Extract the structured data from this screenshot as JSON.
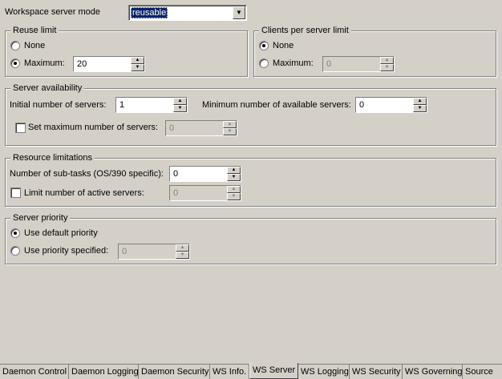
{
  "workspace_mode": {
    "label": "Workspace server mode",
    "value": "reusable"
  },
  "reuse_limit": {
    "title": "Reuse limit",
    "none_label": "None",
    "maximum_label": "Maximum:",
    "maximum_value": "20",
    "selected": "maximum"
  },
  "clients_limit": {
    "title": "Clients per server limit",
    "none_label": "None",
    "maximum_label": "Maximum:",
    "maximum_value": "0",
    "selected": "none"
  },
  "server_availability": {
    "title": "Server availability",
    "initial_label": "Initial number of servers:",
    "initial_value": "1",
    "minimum_label": "Minimum number of available servers:",
    "minimum_value": "0",
    "set_max_label": "Set maximum number of servers:",
    "set_max_value": "0"
  },
  "resource_limitations": {
    "title": "Resource limitations",
    "subtasks_label": "Number of sub-tasks (OS/390 specific):",
    "subtasks_value": "0",
    "limit_active_label": "Limit number of active servers:",
    "limit_active_value": "0"
  },
  "server_priority": {
    "title": "Server priority",
    "default_label": "Use default priority",
    "specified_label": "Use priority specified:",
    "specified_value": "0",
    "selected": "default"
  },
  "tabs": [
    {
      "label": "Daemon Control"
    },
    {
      "label": "Daemon Logging"
    },
    {
      "label": "Daemon Security"
    },
    {
      "label": "WS Info."
    },
    {
      "label": "WS Server"
    },
    {
      "label": "WS Logging"
    },
    {
      "label": "WS Security"
    },
    {
      "label": "WS Governing"
    },
    {
      "label": "Source"
    }
  ],
  "active_tab": "WS Server"
}
